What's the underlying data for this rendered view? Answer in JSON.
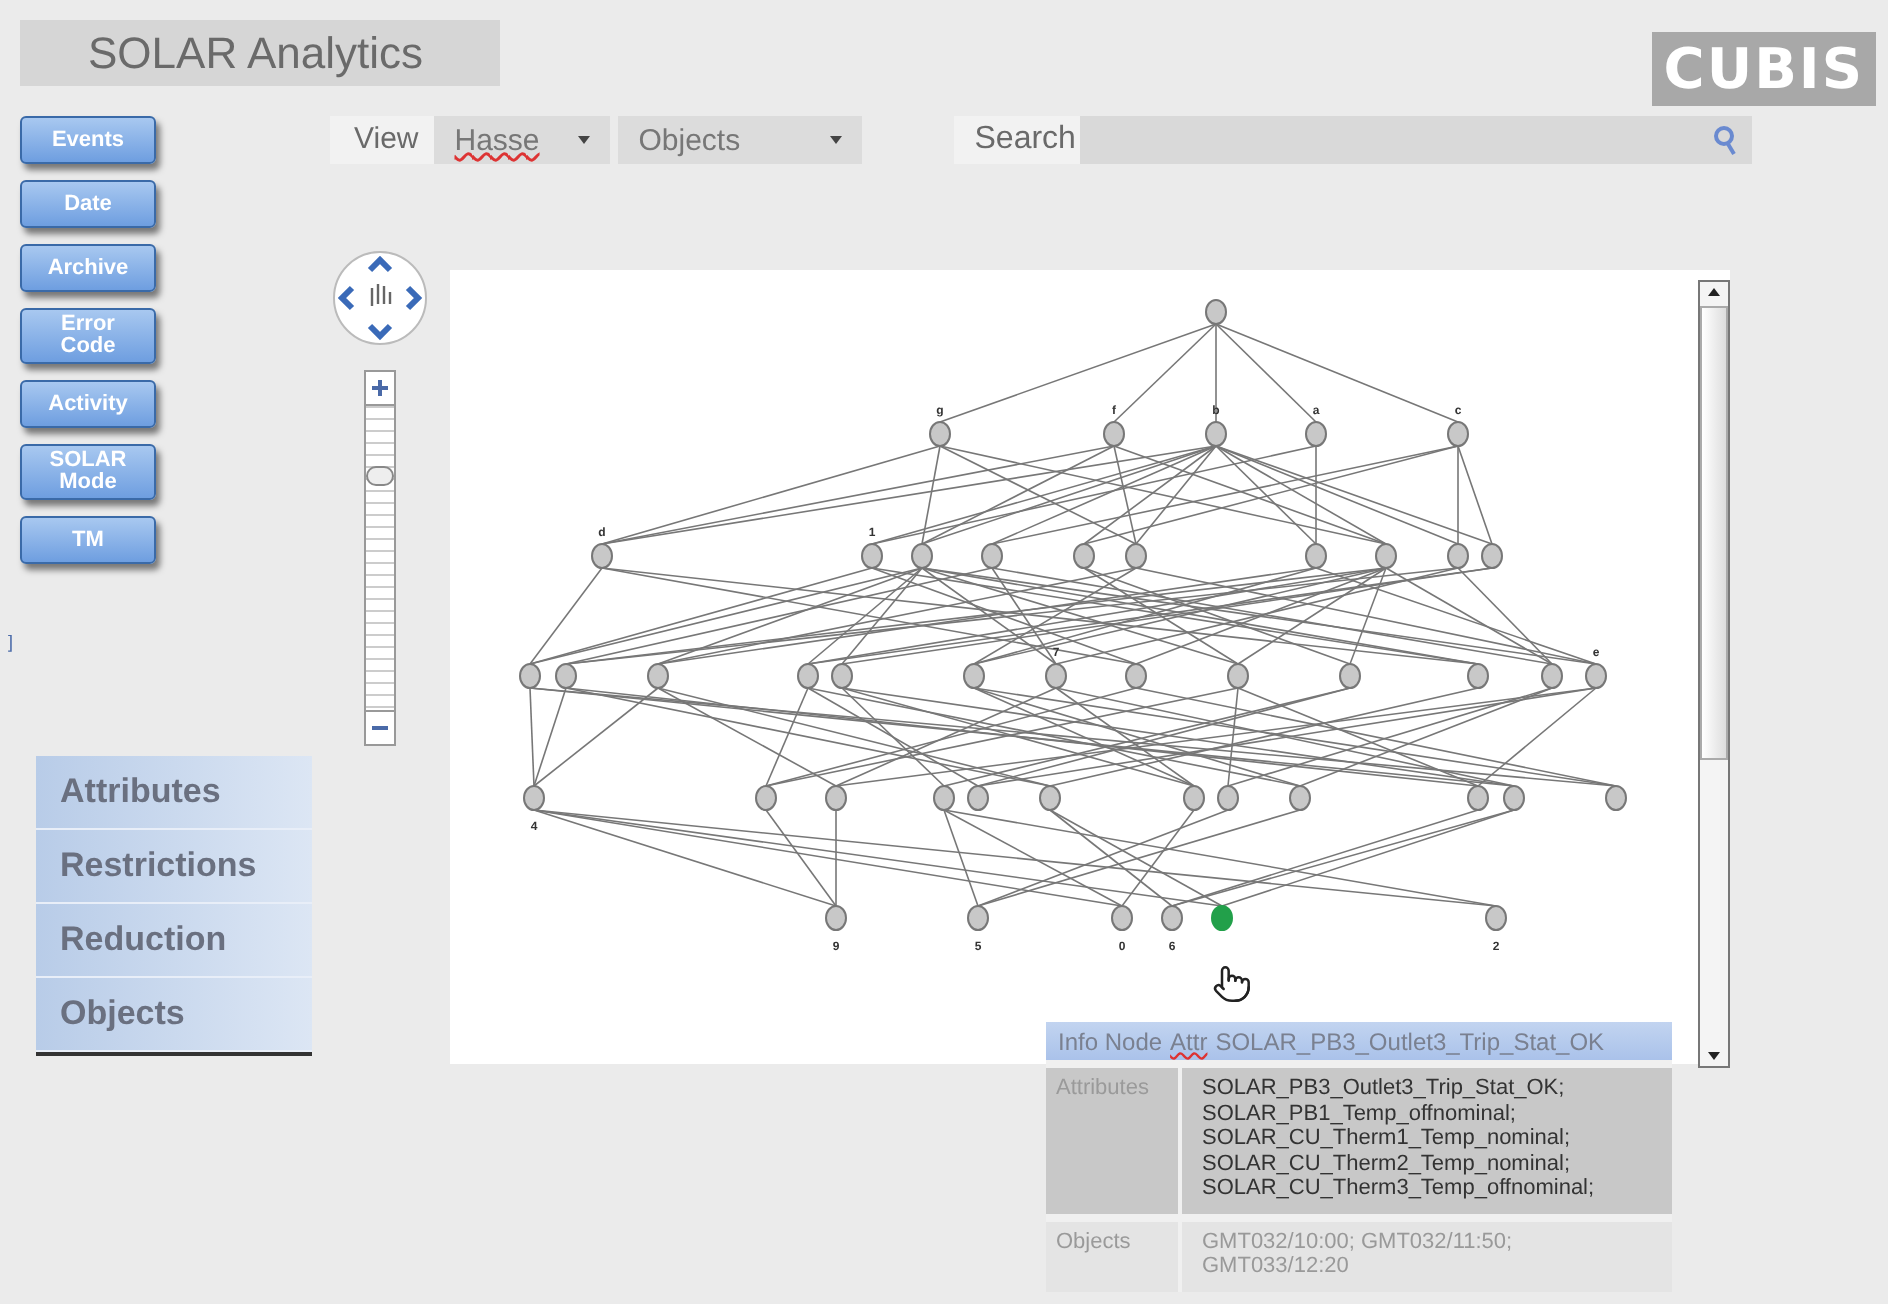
{
  "title": "SOLAR Analytics",
  "logo": "CUBIS",
  "nav_buttons": [
    {
      "label": "Events"
    },
    {
      "label": "Date"
    },
    {
      "label": "Archive"
    },
    {
      "label": "Error Code"
    },
    {
      "label": "Activity"
    },
    {
      "label": "SOLAR Mode"
    },
    {
      "label": "TM"
    }
  ],
  "stray_mark": "]",
  "view_bar": {
    "label": "View",
    "view_select": "Hasse",
    "objects_select": "Objects",
    "search_label": "Search"
  },
  "zoom_slider": {
    "level": 0.75
  },
  "panel_tabs": [
    {
      "label": "Attributes"
    },
    {
      "label": "Restrictions"
    },
    {
      "label": "Reduction"
    },
    {
      "label": "Objects"
    }
  ],
  "graph": {
    "rows": [
      [
        {
          "highlighted": false
        }
      ],
      [
        {
          "label": "g",
          "highlighted": false
        },
        {
          "label": "f",
          "highlighted": false
        },
        {
          "label": "b",
          "highlighted": false
        },
        {
          "label": "a",
          "highlighted": false
        },
        {
          "label": "c",
          "highlighted": false
        }
      ],
      [
        {
          "label": "d",
          "highlighted": false
        },
        {
          "label": "1",
          "highlighted": false
        },
        {
          "highlighted": false
        },
        {
          "highlighted": false
        },
        {
          "highlighted": false
        },
        {
          "highlighted": false
        },
        {
          "highlighted": false
        },
        {
          "highlighted": false
        },
        {
          "highlighted": false
        },
        {
          "highlighted": false
        }
      ],
      [
        {
          "highlighted": false
        },
        {
          "highlighted": false
        },
        {
          "highlighted": false
        },
        {
          "highlighted": false
        },
        {
          "highlighted": false
        },
        {
          "highlighted": false
        },
        {
          "label": "7",
          "highlighted": false
        },
        {
          "highlighted": false
        },
        {
          "highlighted": false
        },
        {
          "highlighted": false
        },
        {
          "highlighted": false
        },
        {
          "highlighted": false
        },
        {
          "label": "e",
          "highlighted": false
        }
      ],
      [
        {
          "label": "4",
          "highlighted": false
        },
        {
          "highlighted": false
        },
        {
          "highlighted": false
        },
        {
          "highlighted": false
        },
        {
          "highlighted": false
        },
        {
          "highlighted": false
        },
        {
          "highlighted": false
        },
        {
          "highlighted": false
        },
        {
          "highlighted": false
        },
        {
          "highlighted": false
        },
        {
          "highlighted": false
        },
        {
          "highlighted": false
        }
      ],
      [
        {
          "label": "9",
          "highlighted": false
        },
        {
          "label": "5",
          "highlighted": false
        },
        {
          "label": "0",
          "highlighted": false
        },
        {
          "label": "6",
          "highlighted": false
        },
        {
          "highlighted": true
        },
        {
          "label": "2",
          "highlighted": false
        }
      ]
    ]
  },
  "info": {
    "header_label": "Info Node",
    "header_attr": "Attr",
    "header_value": "SOLAR_PB3_Outlet3_Trip_Stat_OK",
    "rows": [
      {
        "label": "Attributes",
        "values": [
          "SOLAR_PB3_Outlet3_Trip_Stat_OK;",
          "SOLAR_PB1_Temp_offnominal;",
          "SOLAR_CU_Therm1_Temp_nominal;",
          "SOLAR_CU_Therm2_Temp_nominal;",
          "SOLAR_CU_Therm3_Temp_offnominal;"
        ],
        "dark": true
      },
      {
        "label": "Objects",
        "values": [
          "GMT032/10:00; GMT032/11:50; GMT033/12:20"
        ],
        "dark": false
      }
    ]
  }
}
